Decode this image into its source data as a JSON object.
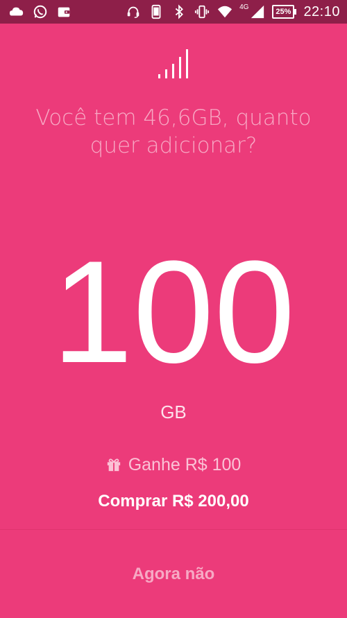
{
  "status_bar": {
    "left_icons": [
      "cloud-icon",
      "whatsapp-icon",
      "wallet-icon"
    ],
    "right_icons": [
      "headset-mic-icon",
      "phone-icon",
      "bluetooth-icon",
      "vibrate-icon",
      "wifi-icon",
      "cell-signal-icon"
    ],
    "network_type": "4G",
    "battery": "25%",
    "time": "22:10"
  },
  "main": {
    "header_icon": "signal-bars-icon",
    "question": "Você tem 46,6GB, quanto quer adicionar?",
    "amount": "100",
    "unit": "GB",
    "bonus_icon": "gift-icon",
    "bonus_text": "Ganhe R$ 100",
    "buy_label": "Comprar R$ 200,00",
    "later_label": "Agora não"
  },
  "colors": {
    "background": "#ec3b7a",
    "status_bar": "#8e1f49",
    "text_primary": "#ffffff",
    "text_secondary": "#f7a9c4"
  }
}
